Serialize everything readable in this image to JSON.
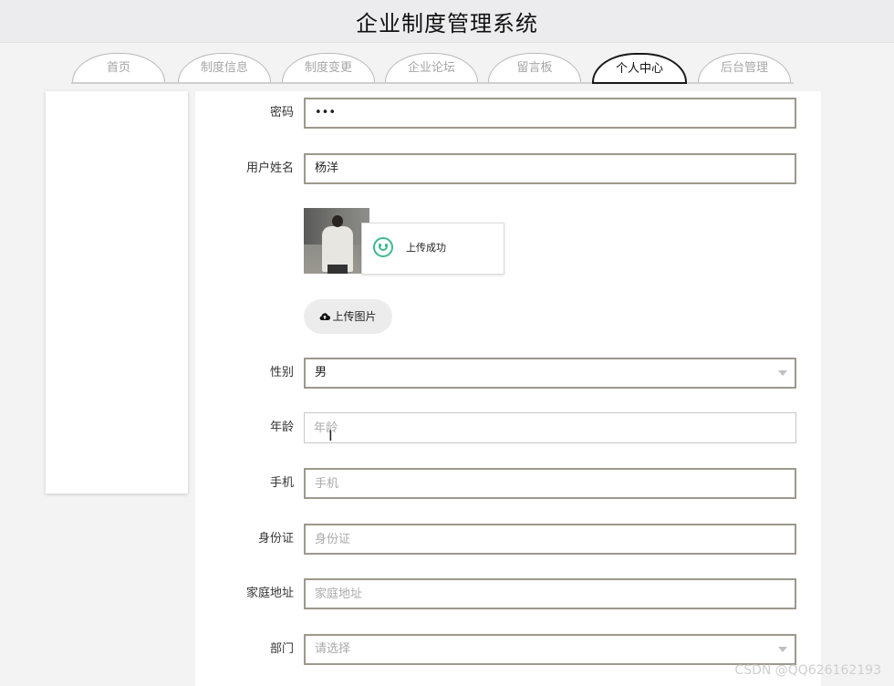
{
  "header": {
    "title": "企业制度管理系统"
  },
  "nav": {
    "tabs": [
      "首页",
      "制度信息",
      "制度变更",
      "企业论坛",
      "留言板",
      "个人中心",
      "后台管理"
    ],
    "active_tab": "个人中心"
  },
  "form": {
    "password": {
      "label": "密码",
      "value": "•••"
    },
    "name": {
      "label": "用户姓名",
      "value": "杨洋"
    },
    "avatar": {
      "toast": "上传成功",
      "upload_button": "上传图片"
    },
    "gender": {
      "label": "性别",
      "value": "男"
    },
    "age": {
      "label": "年龄",
      "placeholder": "年龄",
      "value": ""
    },
    "phone": {
      "label": "手机",
      "placeholder": "手机",
      "value": ""
    },
    "id_card": {
      "label": "身份证",
      "placeholder": "身份证",
      "value": ""
    },
    "address": {
      "label": "家庭地址",
      "placeholder": "家庭地址",
      "value": ""
    },
    "department": {
      "label": "部门",
      "placeholder": "请选择"
    }
  },
  "watermark": "CSDN @QQ626162193",
  "icons": {
    "upload": "cloud-upload-icon",
    "success": "smile-icon",
    "dropdown": "caret-down-icon"
  },
  "colors": {
    "success": "#3cba8c",
    "active_tab_border": "#1a1a1a",
    "input_border": "#9c988c"
  }
}
